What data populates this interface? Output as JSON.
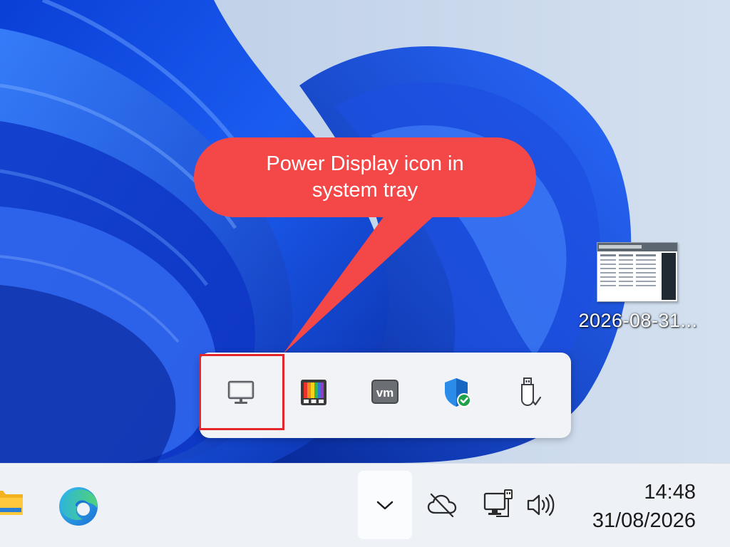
{
  "callout": {
    "text": "Power Display icon in system tray",
    "color": "#f44848"
  },
  "desktop": {
    "file_label": "2026-08-31..."
  },
  "tray_flyout": {
    "icons": [
      {
        "name": "power-display-icon",
        "highlighted": true
      },
      {
        "name": "color-palette-icon"
      },
      {
        "name": "vmware-icon",
        "text": "vm"
      },
      {
        "name": "windows-security-icon"
      },
      {
        "name": "usb-safely-remove-icon"
      }
    ],
    "highlight_color": "#e3262b"
  },
  "taskbar": {
    "pinned": [
      {
        "name": "file-explorer-icon"
      },
      {
        "name": "edge-browser-icon"
      }
    ],
    "system_tray": [
      {
        "name": "show-hidden-icons-chevron"
      },
      {
        "name": "onedrive-offline-icon"
      },
      {
        "name": "network-icon"
      },
      {
        "name": "volume-icon"
      }
    ],
    "clock": {
      "time": "14:48",
      "date": "31/08/2026"
    }
  }
}
